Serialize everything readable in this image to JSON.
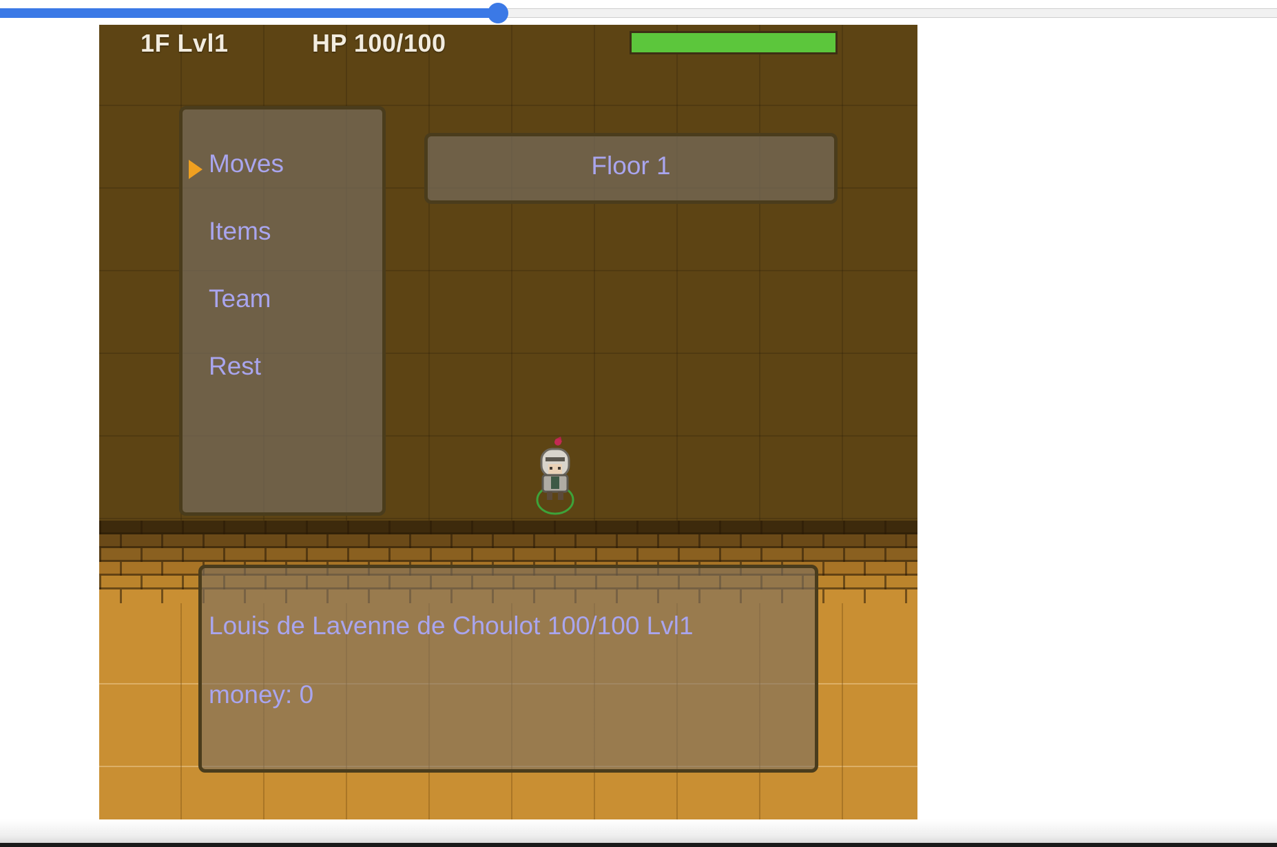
{
  "progress_slider": {
    "value": 0.39,
    "accent": "#3b79e6"
  },
  "hud": {
    "floor_level": "1F Lvl1",
    "hp_text": "HP 100/100",
    "hp_fraction": 1.0,
    "hp_bar_color": "#5cc63c"
  },
  "menu": {
    "cursor_icon": "triangle-pointer-icon",
    "cursor_color": "#f0a020",
    "items": [
      {
        "label": "Moves",
        "selected": true
      },
      {
        "label": "Items",
        "selected": false
      },
      {
        "label": "Team",
        "selected": false
      },
      {
        "label": "Rest",
        "selected": false
      }
    ]
  },
  "floor_panel": {
    "label": "Floor 1"
  },
  "status_panel": {
    "character_line": "Louis de Lavenne de Choulot  100/100 Lvl1",
    "money_line": "money: 0"
  },
  "player": {
    "sprite": "armored-knight-sprite-icon"
  },
  "colors": {
    "menu_text": "#a9a5ee",
    "dark_floor": "#5d4414",
    "light_floor": "#c98f33"
  }
}
